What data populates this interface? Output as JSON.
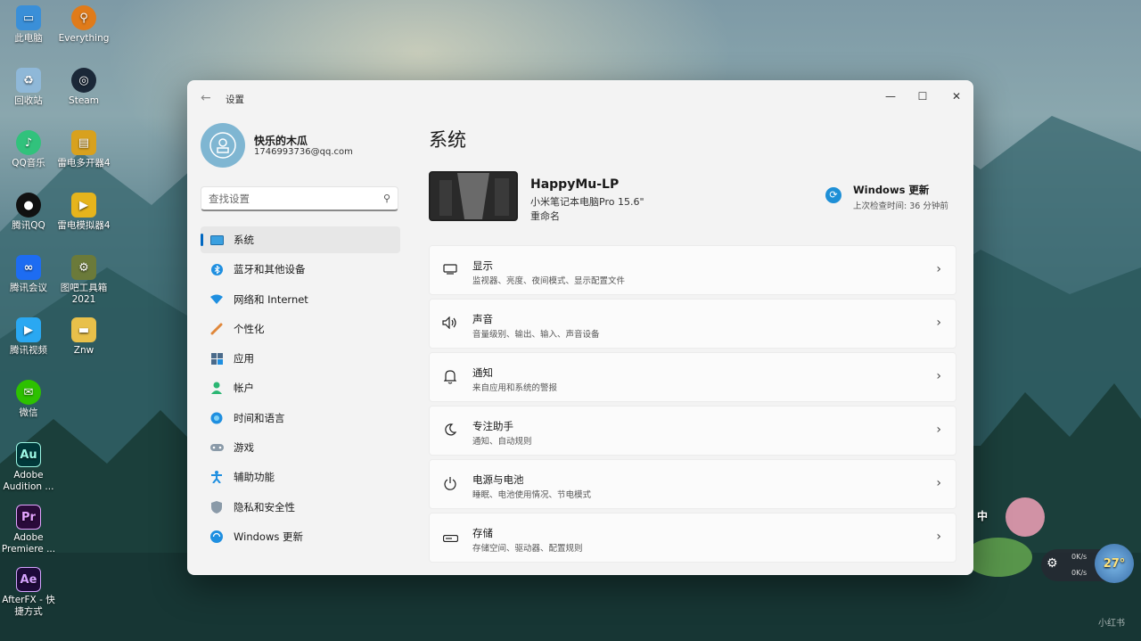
{
  "desktop": {
    "icons": [
      {
        "label": "此电脑",
        "icon": "computer-icon",
        "color": "#3a8fd8"
      },
      {
        "label": "Everything",
        "icon": "magnifier-icon",
        "color": "#e07b1a"
      },
      {
        "label": "回收站",
        "icon": "recycle-bin-icon",
        "color": "#8fb8d8"
      },
      {
        "label": "Steam",
        "icon": "steam-icon",
        "color": "#1b2838"
      },
      {
        "label": "QQ音乐",
        "icon": "qq-music-icon",
        "color": "#31c27c"
      },
      {
        "label": "雷电多开器4",
        "icon": "ldmulti-icon",
        "color": "#d8a11e"
      },
      {
        "label": "腾讯QQ",
        "icon": "qq-penguin-icon",
        "color": "#111111"
      },
      {
        "label": "雷电模拟器4",
        "icon": "ldplayer-icon",
        "color": "#e6b41c"
      },
      {
        "label": "腾讯会议",
        "icon": "tencent-meeting-icon",
        "color": "#1d6cf2"
      },
      {
        "label": "图吧工具箱\n2021",
        "icon": "toolbox-icon",
        "color": "#6b7a3a"
      },
      {
        "label": "腾讯视频",
        "icon": "tencent-video-icon",
        "color": "#2aa8f2"
      },
      {
        "label": "Znw",
        "icon": "folder-icon",
        "color": "#e8c04a"
      },
      {
        "label": "微信",
        "icon": "wechat-icon",
        "color": "#2dc100"
      },
      {
        "label": "Adobe\nAudition ...",
        "icon": "audition-icon",
        "color": "#00383a",
        "glyph": "Au"
      },
      {
        "label": "Adobe\nPremiere ...",
        "icon": "premiere-icon",
        "color": "#2a0a3a",
        "glyph": "Pr"
      },
      {
        "label": "AfterFX - 快\n捷方式",
        "icon": "aftereffects-icon",
        "color": "#1e0a3a",
        "glyph": "Ae"
      }
    ],
    "widget": {
      "ime": "中",
      "up_speed": "0K/s",
      "down_speed": "0K/s",
      "temp": "27°"
    },
    "watermark": "小红书"
  },
  "window": {
    "title": "设置",
    "controls": {
      "minimize": "—",
      "maximize": "☐",
      "close": "✕"
    },
    "back": "←"
  },
  "profile": {
    "name": "快乐的木瓜",
    "email": "1746993736@qq.com"
  },
  "search": {
    "placeholder": "查找设置"
  },
  "nav": {
    "items": [
      {
        "label": "系统",
        "icon": "monitor-icon",
        "active": true
      },
      {
        "label": "蓝牙和其他设备",
        "icon": "bluetooth-icon"
      },
      {
        "label": "网络和 Internet",
        "icon": "wifi-icon"
      },
      {
        "label": "个性化",
        "icon": "brush-icon"
      },
      {
        "label": "应用",
        "icon": "apps-icon"
      },
      {
        "label": "帐户",
        "icon": "person-icon"
      },
      {
        "label": "时间和语言",
        "icon": "globe-clock-icon"
      },
      {
        "label": "游戏",
        "icon": "gamepad-icon"
      },
      {
        "label": "辅助功能",
        "icon": "accessibility-icon"
      },
      {
        "label": "隐私和安全性",
        "icon": "shield-icon"
      },
      {
        "label": "Windows 更新",
        "icon": "update-icon"
      }
    ]
  },
  "main": {
    "title": "系统",
    "device": {
      "name": "HappyMu-LP",
      "model": "小米笔记本电脑Pro 15.6\"",
      "rename": "重命名"
    },
    "windows_update": {
      "title": "Windows 更新",
      "subtitle": "上次检查时间: 36 分钟前"
    },
    "cards": [
      {
        "title": "显示",
        "subtitle": "监视器、亮度、夜间模式、显示配置文件",
        "icon": "display-icon"
      },
      {
        "title": "声音",
        "subtitle": "音量级别、输出、输入、声音设备",
        "icon": "speaker-icon"
      },
      {
        "title": "通知",
        "subtitle": "来自应用和系统的警报",
        "icon": "bell-icon"
      },
      {
        "title": "专注助手",
        "subtitle": "通知、自动规则",
        "icon": "moon-icon"
      },
      {
        "title": "电源与电池",
        "subtitle": "睡眠、电池使用情况、节电模式",
        "icon": "power-icon"
      },
      {
        "title": "存储",
        "subtitle": "存储空间、驱动器、配置规则",
        "icon": "storage-icon"
      }
    ]
  }
}
